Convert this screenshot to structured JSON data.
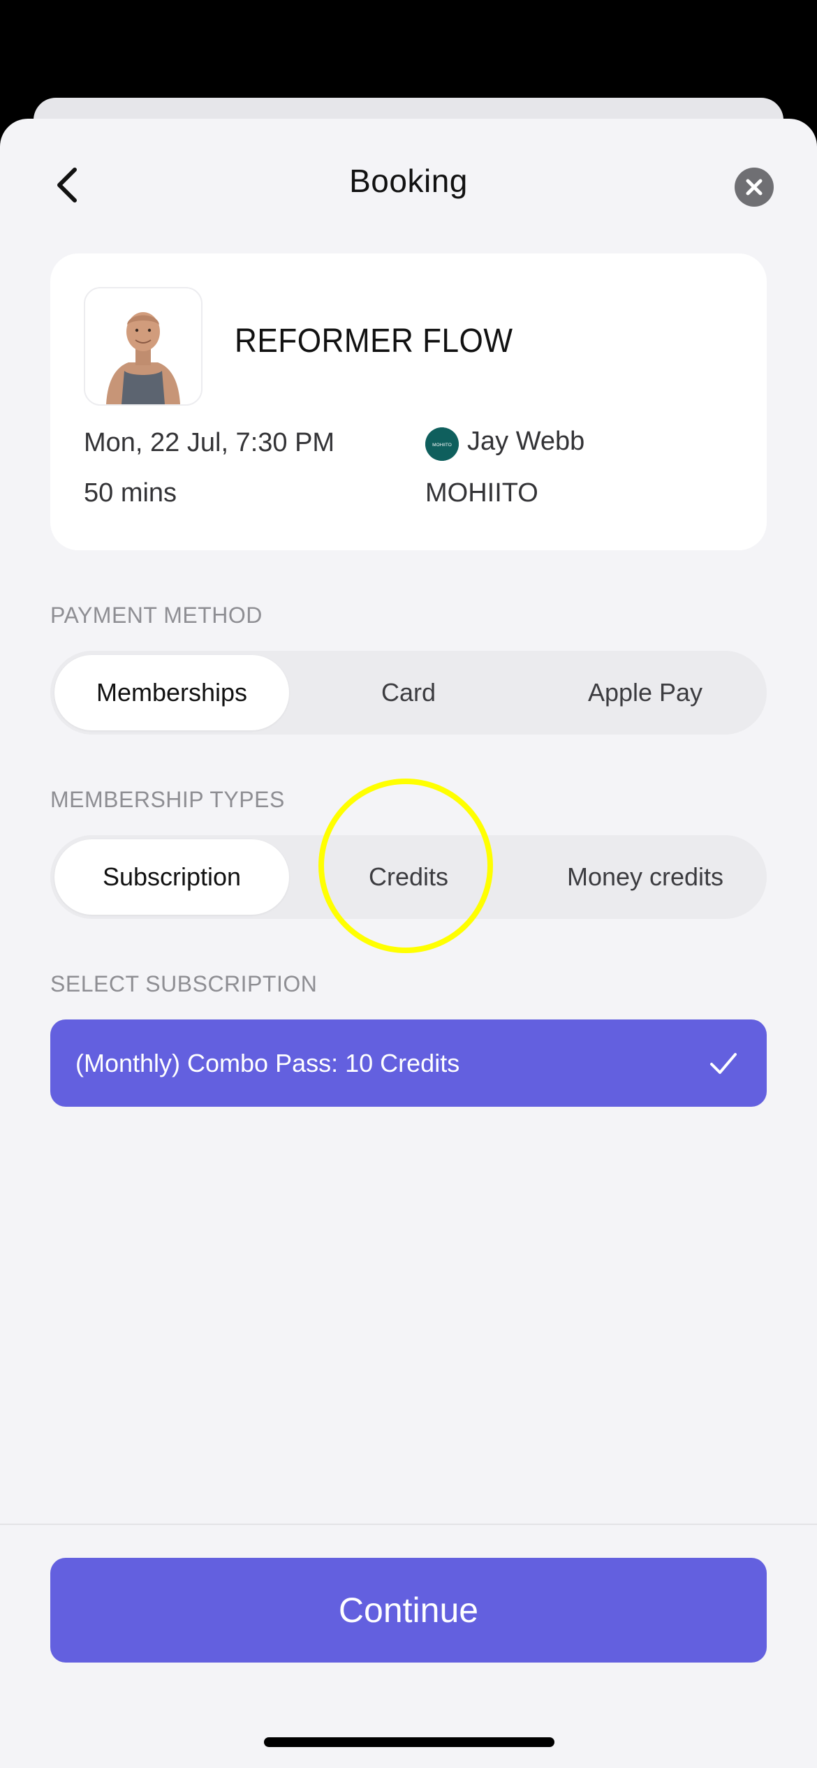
{
  "header": {
    "title": "Booking"
  },
  "class_card": {
    "name": "REFORMER FLOW",
    "datetime": "Mon, 22 Jul, 7:30 PM",
    "duration": "50 mins",
    "instructor": "Jay Webb",
    "studio": "MOHIITO",
    "studio_logo_text": "MOHIITO"
  },
  "payment_method": {
    "label": "PAYMENT METHOD",
    "options": [
      "Memberships",
      "Card",
      "Apple Pay"
    ],
    "selected": "Memberships"
  },
  "membership_types": {
    "label": "MEMBERSHIP TYPES",
    "options": [
      "Subscription",
      "Credits",
      "Money credits"
    ],
    "selected": "Subscription"
  },
  "select_subscription": {
    "label": "SELECT SUBSCRIPTION",
    "option_label": "(Monthly) Combo Pass: 10 Credits",
    "selected": true
  },
  "footer": {
    "continue_label": "Continue"
  },
  "colors": {
    "accent": "#6360df",
    "background": "#f4f4f7",
    "highlight": "#ffff00",
    "studio_logo": "#0f5f5d"
  },
  "icons": {
    "back": "chevron-left-icon",
    "close": "close-icon",
    "check": "checkmark-icon"
  }
}
